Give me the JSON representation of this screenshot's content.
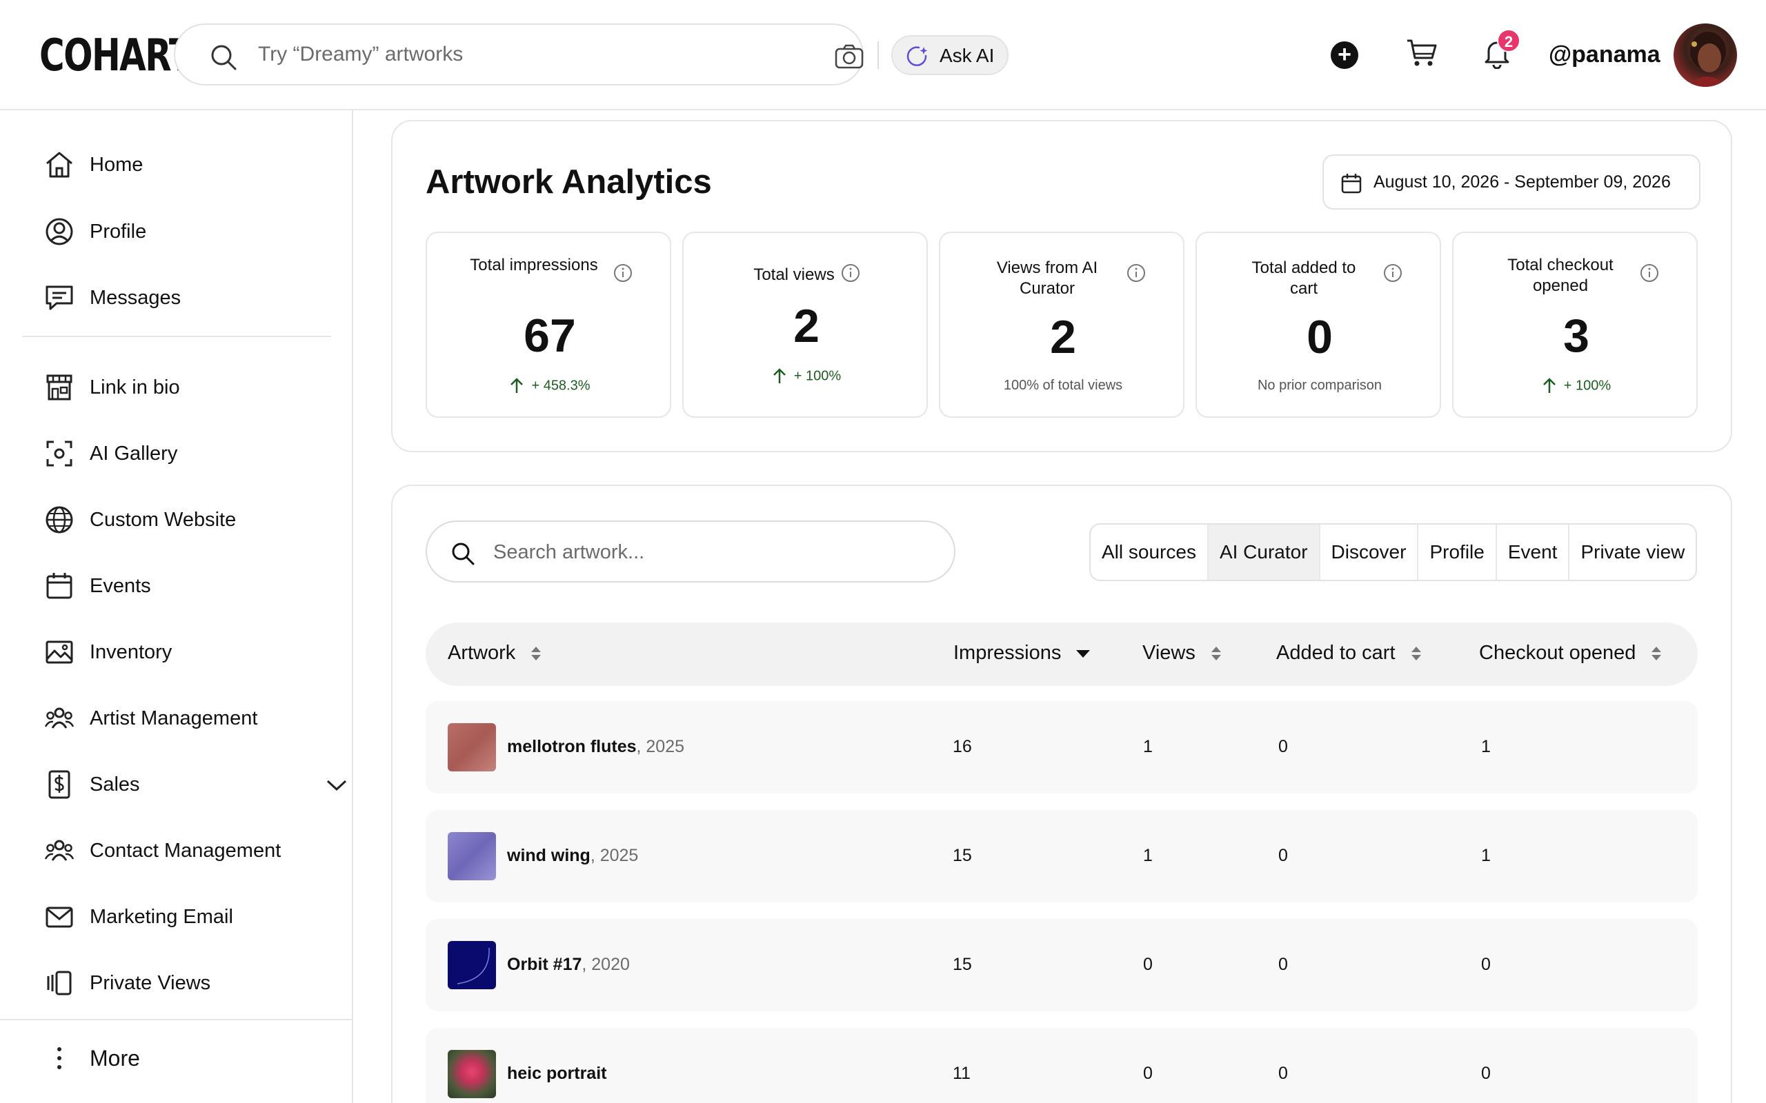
{
  "header": {
    "logo": "COHART",
    "search_placeholder": "Try “Dreamy” artworks",
    "ask_ai_label": "Ask AI",
    "notification_count": "2",
    "username": "@panama"
  },
  "sidebar": {
    "items": [
      {
        "label": "Home",
        "icon": "home-icon"
      },
      {
        "label": "Profile",
        "icon": "user-circle-icon"
      },
      {
        "label": "Messages",
        "icon": "message-icon"
      },
      {
        "label": "Link in bio",
        "icon": "storefront-icon"
      },
      {
        "label": "AI Gallery",
        "icon": "scan-icon"
      },
      {
        "label": "Custom Website",
        "icon": "globe-icon"
      },
      {
        "label": "Events",
        "icon": "calendar-icon"
      },
      {
        "label": "Inventory",
        "icon": "image-icon"
      },
      {
        "label": "Artist Management",
        "icon": "users-icon"
      },
      {
        "label": "Sales",
        "icon": "dollar-doc-icon"
      },
      {
        "label": "Contact Management",
        "icon": "contacts-icon"
      },
      {
        "label": "Marketing Email",
        "icon": "mail-icon"
      },
      {
        "label": "Private Views",
        "icon": "gallery-views-icon"
      }
    ],
    "more_label": "More"
  },
  "analytics": {
    "title": "Artwork Analytics",
    "date_range": "August 10, 2026 - September 09, 2026",
    "stats": [
      {
        "title": "Total impressions",
        "value": "67",
        "change": "+ 458.3%",
        "trend": "up"
      },
      {
        "title": "Total views",
        "value": "2",
        "change": "+ 100%",
        "trend": "up"
      },
      {
        "title": "Views from AI Curator",
        "value": "2",
        "change": "100% of total views",
        "trend": "none"
      },
      {
        "title": "Total added to cart",
        "value": "0",
        "change": "No prior comparison",
        "trend": "none"
      },
      {
        "title": "Total checkout opened",
        "value": "3",
        "change": "+ 100%",
        "trend": "up"
      }
    ]
  },
  "table": {
    "search_placeholder": "Search artwork...",
    "filters": [
      "All sources",
      "AI Curator",
      "Discover",
      "Profile",
      "Event",
      "Private view"
    ],
    "active_filter": "AI Curator",
    "columns": [
      "Artwork",
      "Impressions",
      "Views",
      "Added to cart",
      "Checkout opened"
    ],
    "rows": [
      {
        "title": "mellotron flutes",
        "year": ", 2025",
        "impressions": "16",
        "views": "1",
        "added_to_cart": "0",
        "checkout_opened": "1",
        "thumb_color": "#b56a62"
      },
      {
        "title": "wind wing",
        "year": ", 2025",
        "impressions": "15",
        "views": "1",
        "added_to_cart": "0",
        "checkout_opened": "1",
        "thumb_color": "#7f78c4"
      },
      {
        "title": "Orbit #17",
        "year": ", 2020",
        "impressions": "15",
        "views": "0",
        "added_to_cart": "0",
        "checkout_opened": "0",
        "thumb_color": "#0a0a6e"
      },
      {
        "title": "heic portrait",
        "year": "",
        "impressions": "11",
        "views": "0",
        "added_to_cart": "0",
        "checkout_opened": "0",
        "thumb_color": "#c2335a"
      }
    ]
  },
  "colors": {
    "accent_badge": "#e8356b",
    "positive_change": "#1b5e20"
  }
}
